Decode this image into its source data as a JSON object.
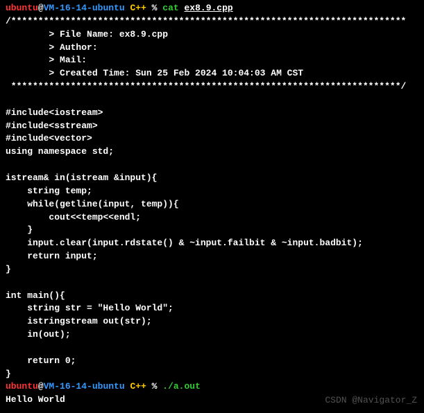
{
  "prompt1": {
    "user": "ubuntu",
    "at": "@",
    "host": "VM-16-14-ubuntu",
    "dir": " C++",
    "pct": " % ",
    "cmd": "cat",
    "arg": "ex8.9.cpp"
  },
  "file_header": {
    "top": "/*************************************************************************",
    "l1": "        > File Name: ex8.9.cpp",
    "l2": "        > Author:",
    "l3": "        > Mail:",
    "l4": "        > Created Time: Sun 25 Feb 2024 10:04:03 AM CST",
    "bot": " ************************************************************************/"
  },
  "code": {
    "l1": "#include<iostream>",
    "l2": "#include<sstream>",
    "l3": "#include<vector>",
    "l4": "using namespace std;",
    "l5": "istream& in(istream &input){",
    "l6": "    string temp;",
    "l7": "    while(getline(input, temp)){",
    "l8": "        cout<<temp<<endl;",
    "l9": "    }",
    "l10": "    input.clear(input.rdstate() & ~input.failbit & ~input.badbit);",
    "l11": "    return input;",
    "l12": "}",
    "l13": "int main(){",
    "l14": "    string str = \"Hello World\";",
    "l15": "    istringstream out(str);",
    "l16": "    in(out);",
    "l17": "    return 0;",
    "l18": "}"
  },
  "prompt2": {
    "user": "ubuntu",
    "at": "@",
    "host": "VM-16-14-ubuntu",
    "dir": " C++",
    "pct": " % ",
    "cmd": "./a.out"
  },
  "output": "Hello World",
  "watermark": "CSDN @Navigator_Z"
}
